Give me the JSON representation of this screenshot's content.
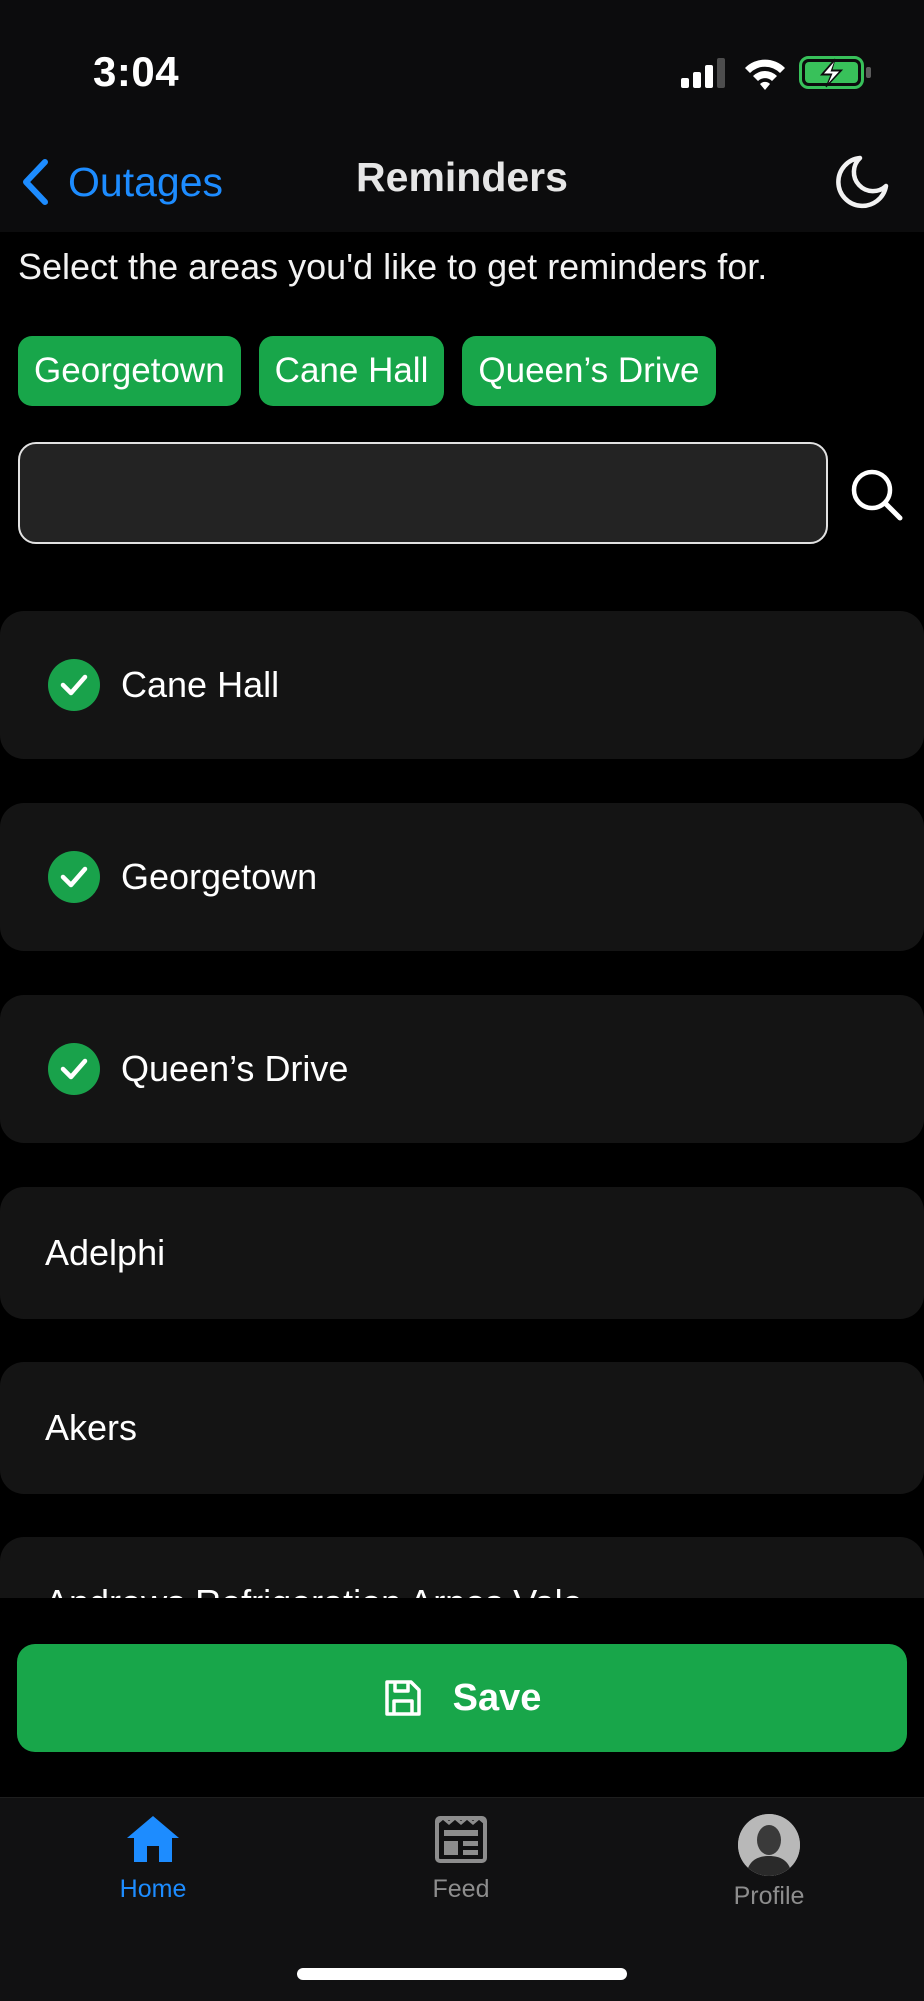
{
  "status_bar": {
    "time": "3:04"
  },
  "nav": {
    "back_label": "Outages",
    "title": "Reminders"
  },
  "intro_text": "Select the areas you'd like to get reminders for.",
  "chips": [
    "Georgetown",
    "Cane Hall",
    "Queen’s Drive"
  ],
  "search": {
    "value": "",
    "placeholder": ""
  },
  "areas": [
    {
      "name": "Cane Hall",
      "selected": true
    },
    {
      "name": "Georgetown",
      "selected": true
    },
    {
      "name": "Queen’s Drive",
      "selected": true
    },
    {
      "name": "Adelphi",
      "selected": false
    },
    {
      "name": "Akers",
      "selected": false
    },
    {
      "name": "Andrews Refrigeration Arnos Vale",
      "selected": false
    }
  ],
  "save_button": {
    "label": "Save"
  },
  "tabs": [
    {
      "label": "Home",
      "active": true,
      "icon": "home-icon"
    },
    {
      "label": "Feed",
      "active": false,
      "icon": "feed-icon"
    },
    {
      "label": "Profile",
      "active": false,
      "icon": "avatar"
    }
  ],
  "colors": {
    "accent_blue": "#1d8cff",
    "accent_green": "#18a64a",
    "card_background": "#141414"
  }
}
